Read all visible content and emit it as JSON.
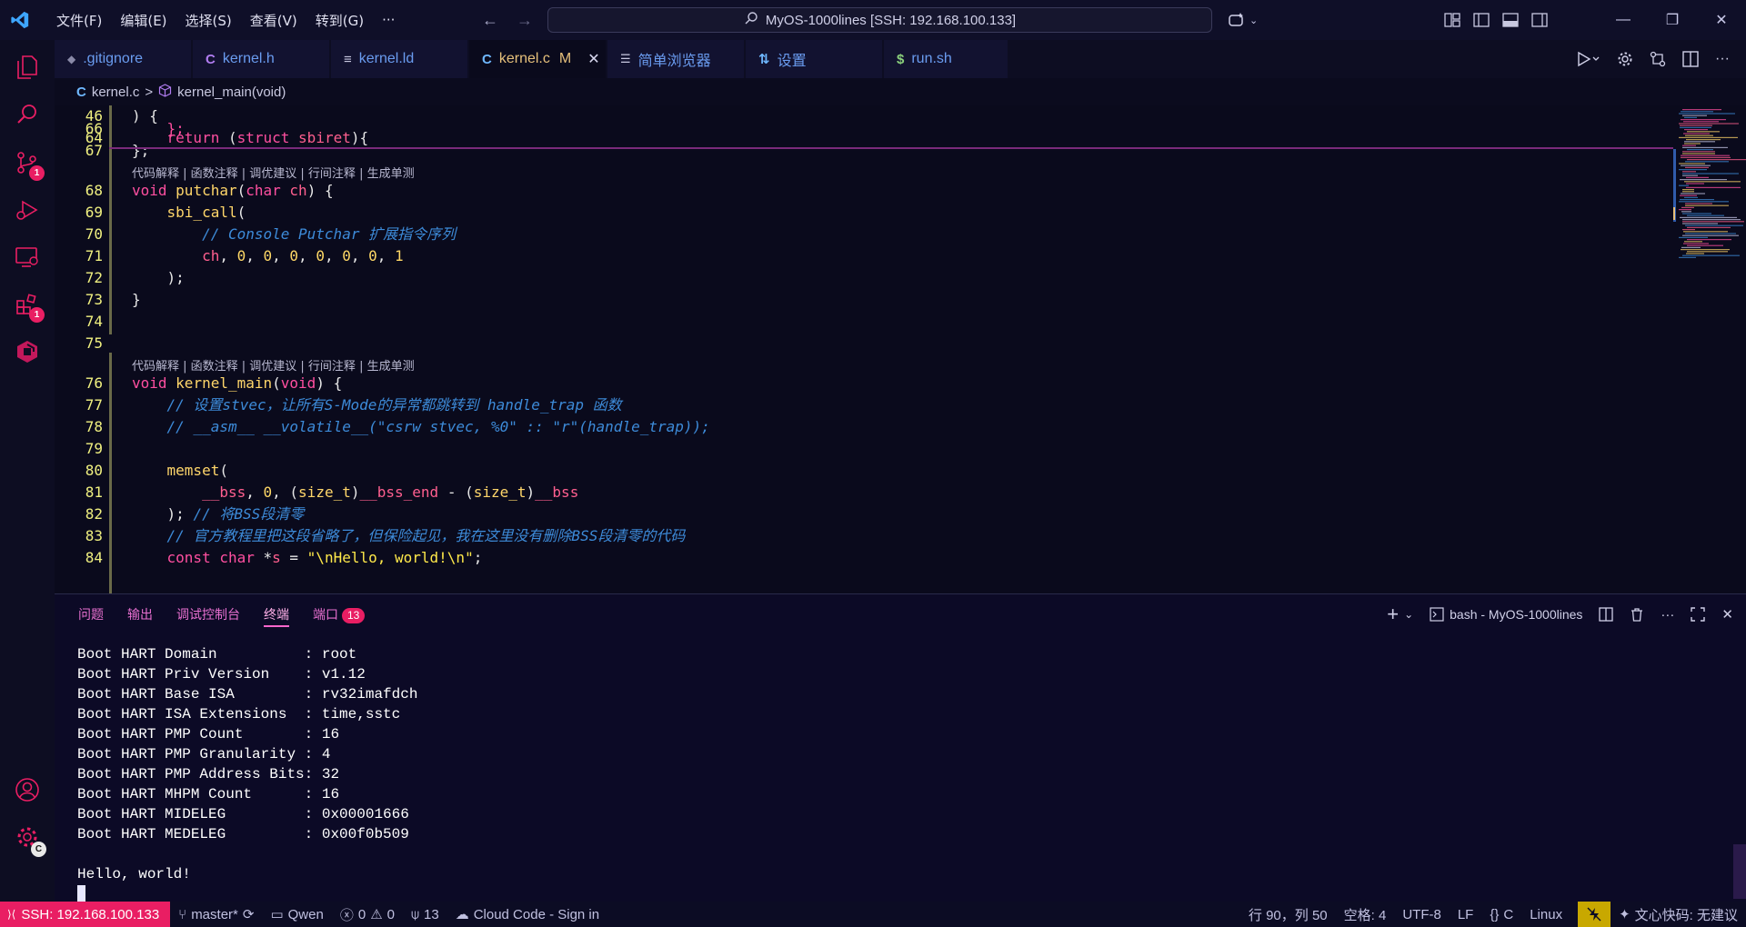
{
  "menu": [
    "文件(F)",
    "编辑(E)",
    "选择(S)",
    "查看(V)",
    "转到(G)",
    "···"
  ],
  "command_center": {
    "label": "MyOS-1000lines [SSH: 192.168.100.133]"
  },
  "activity": {
    "source_control_badge": "1",
    "extensions_badge": "1",
    "settings_badge": "C"
  },
  "tabs": [
    {
      "icon": "◆",
      "label": ".gitignore"
    },
    {
      "icon": "C",
      "label": "kernel.h"
    },
    {
      "icon": "≡",
      "label": "kernel.ld"
    },
    {
      "icon": "C",
      "label": "kernel.c",
      "modified": "M",
      "close": "✕"
    },
    {
      "icon": "☰",
      "label": "简单浏览器"
    },
    {
      "icon": "⇅",
      "label": "设置"
    },
    {
      "icon": "$",
      "label": "run.sh"
    }
  ],
  "breadcrumb": {
    "file": "kernel.c",
    "sep": ">",
    "symbol": "kernel_main(void)"
  },
  "codelens": "代码解释 | 函数注释 | 调优建议 | 行间注释 | 生成单测",
  "sticky": [
    {
      "ln": "46",
      "tokens": [
        {
          "t": ") {",
          "c": "pu"
        }
      ]
    },
    {
      "ln": "64",
      "tokens": [
        {
          "t": "    return ",
          "c": "kw"
        },
        {
          "t": "(",
          "c": "pu"
        },
        {
          "t": "struct ",
          "c": "kw"
        },
        {
          "t": "sbiret",
          "c": "id"
        },
        {
          "t": "){",
          "c": "pu"
        }
      ]
    }
  ],
  "lines": [
    {
      "ln": "66",
      "tokens": [
        {
          "t": "    };",
          "c": "kw"
        }
      ]
    },
    {
      "ln": "67",
      "tokens": [
        {
          "t": "};",
          "c": "pu"
        }
      ]
    },
    {
      "ln": "68",
      "tokens": [
        {
          "t": "void ",
          "c": "kw"
        },
        {
          "t": "putchar",
          "c": "fn"
        },
        {
          "t": "(",
          "c": "pu"
        },
        {
          "t": "char ",
          "c": "kw"
        },
        {
          "t": "ch",
          "c": "id"
        },
        {
          "t": ") {",
          "c": "pu"
        }
      ]
    },
    {
      "ln": "69",
      "tokens": [
        {
          "t": "    sbi_call",
          "c": "fn"
        },
        {
          "t": "(",
          "c": "pu"
        }
      ]
    },
    {
      "ln": "70",
      "tokens": [
        {
          "t": "        // Console Putchar 扩展指令序列",
          "c": "com"
        }
      ]
    },
    {
      "ln": "71",
      "tokens": [
        {
          "t": "        ch",
          "c": "id"
        },
        {
          "t": ", ",
          "c": "pu"
        },
        {
          "t": "0",
          "c": "num"
        },
        {
          "t": ", ",
          "c": "pu"
        },
        {
          "t": "0",
          "c": "num"
        },
        {
          "t": ", ",
          "c": "pu"
        },
        {
          "t": "0",
          "c": "num"
        },
        {
          "t": ", ",
          "c": "pu"
        },
        {
          "t": "0",
          "c": "num"
        },
        {
          "t": ", ",
          "c": "pu"
        },
        {
          "t": "0",
          "c": "num"
        },
        {
          "t": ", ",
          "c": "pu"
        },
        {
          "t": "0",
          "c": "num"
        },
        {
          "t": ", ",
          "c": "pu"
        },
        {
          "t": "1",
          "c": "num"
        }
      ]
    },
    {
      "ln": "72",
      "tokens": [
        {
          "t": "    );",
          "c": "pu"
        }
      ]
    },
    {
      "ln": "73",
      "tokens": [
        {
          "t": "}",
          "c": "pu"
        }
      ]
    },
    {
      "ln": "74",
      "tokens": []
    },
    {
      "ln": "75",
      "tokens": []
    },
    {
      "ln": "76",
      "tokens": [
        {
          "t": "void ",
          "c": "kw"
        },
        {
          "t": "kernel_main",
          "c": "fn"
        },
        {
          "t": "(",
          "c": "pu"
        },
        {
          "t": "void",
          "c": "kw"
        },
        {
          "t": ") {",
          "c": "pu"
        }
      ]
    },
    {
      "ln": "77",
      "tokens": [
        {
          "t": "    // 设置stvec，让所有S-Mode的异常都跳转到 handle_trap 函数",
          "c": "com"
        }
      ]
    },
    {
      "ln": "78",
      "tokens": [
        {
          "t": "    // __asm__ __volatile__(\"csrw stvec, %0\" :: \"r\"(handle_trap));",
          "c": "com"
        }
      ]
    },
    {
      "ln": "79",
      "tokens": []
    },
    {
      "ln": "80",
      "tokens": [
        {
          "t": "    memset",
          "c": "fn"
        },
        {
          "t": "(",
          "c": "pu"
        }
      ]
    },
    {
      "ln": "81",
      "tokens": [
        {
          "t": "        __bss",
          "c": "id"
        },
        {
          "t": ", ",
          "c": "pu"
        },
        {
          "t": "0",
          "c": "num"
        },
        {
          "t": ", (",
          "c": "pu"
        },
        {
          "t": "size_t",
          "c": "fn"
        },
        {
          "t": ")",
          "c": "pu"
        },
        {
          "t": "__bss_end ",
          "c": "id"
        },
        {
          "t": "- (",
          "c": "pu"
        },
        {
          "t": "size_t",
          "c": "fn"
        },
        {
          "t": ")",
          "c": "pu"
        },
        {
          "t": "__bss",
          "c": "id"
        }
      ]
    },
    {
      "ln": "82",
      "tokens": [
        {
          "t": "    ); ",
          "c": "pu"
        },
        {
          "t": "// 将BSS段清零",
          "c": "com"
        }
      ]
    },
    {
      "ln": "83",
      "tokens": [
        {
          "t": "    // 官方教程里把这段省略了，但保险起见，我在这里没有删除BSS段清零的代码",
          "c": "com"
        }
      ]
    },
    {
      "ln": "84",
      "tokens": [
        {
          "t": "    const ",
          "c": "kw"
        },
        {
          "t": "char ",
          "c": "kw"
        },
        {
          "t": "*",
          "c": "pu"
        },
        {
          "t": "s ",
          "c": "id"
        },
        {
          "t": "= ",
          "c": "pu"
        },
        {
          "t": "\"\\nHello, world!\\n\"",
          "c": "str"
        },
        {
          "t": ";",
          "c": "pu"
        }
      ]
    }
  ],
  "panel": {
    "tabs": [
      "问题",
      "输出",
      "调试控制台",
      "终端",
      "端口"
    ],
    "ports_badge": "13",
    "terminal_name": "bash - MyOS-1000lines"
  },
  "terminal": [
    "Boot HART Domain          : root",
    "Boot HART Priv Version    : v1.12",
    "Boot HART Base ISA        : rv32imafdch",
    "Boot HART ISA Extensions  : time,sstc",
    "Boot HART PMP Count       : 16",
    "Boot HART PMP Granularity : 4",
    "Boot HART PMP Address Bits: 32",
    "Boot HART MHPM Count      : 16",
    "Boot HART MIDELEG         : 0x00001666",
    "Boot HART MEDELEG         : 0x00f0b509",
    "",
    "Hello, world!"
  ],
  "status": {
    "remote": "SSH: 192.168.100.133",
    "branch": "master*",
    "qwen": "Qwen",
    "errors": "0",
    "warnings": "0",
    "ports": "13",
    "cloud": "Cloud Code - Sign in",
    "position": "行 90，列 50",
    "spaces": "空格: 4",
    "encoding": "UTF-8",
    "eol": "LF",
    "language": "C",
    "platform": "Linux",
    "assistant": "文心快码: 无建议"
  },
  "colors": {
    "accent": "#e91e63",
    "keyword": "#ff4fa0",
    "function": "#ffd66a",
    "comment": "#3d8bd9",
    "number": "#ffd866"
  }
}
